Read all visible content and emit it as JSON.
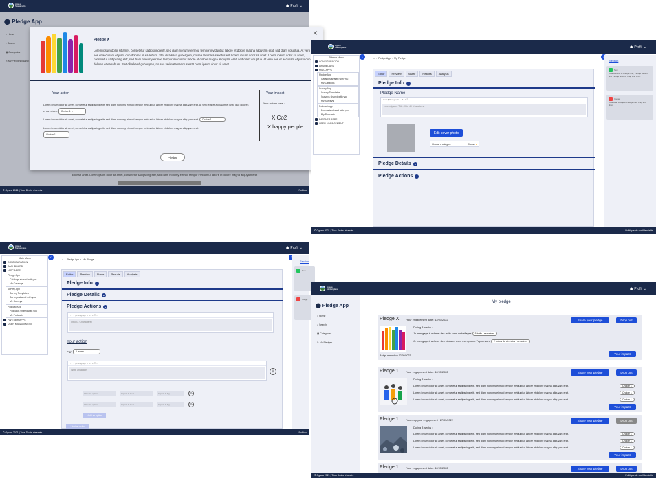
{
  "brand": {
    "logo_line1": "Agsea",
    "logo_line2": "Sustainable",
    "logo_line3": "Marketplace",
    "profile": "Profil"
  },
  "footer": {
    "copyright": "© Ogsea 2021 | Tous Droits réservés",
    "privacy": "Politique de confidentialité",
    "privacy_short": "Politiqu"
  },
  "p1": {
    "app_title": "Pledge App",
    "nav": [
      "Home",
      "Search",
      "Categories",
      "My Pledges (Blank)"
    ],
    "modal": {
      "title": "Pledge X",
      "desc": "Lorem ipsum dolor sit amet, consetetur sadipscing elitr, sed diam nonumy eirmod tempor invidunt ut labore et dolore magna aliquyam erat, sed diam voluptua. At vero eos et accusam et justo duo dolores et ea rebum. Stet clita kasd gubergren, no sea takimata sanctus est Lorem ipsum dolor sit amet. Lorem ipsum dolor sit amet, consetetur sadipscing elitr, sed diam nonumy eirmod tempor invidunt ut labore et dolore magna aliquyam erat, sed diam voluptua. At vero eos et accusam et justo duo dolores et ea rebum. Stet clita kasd gubergren, no sea takimata sanctus est Lorem ipsum dolor sit amet.",
      "your_action": "Your action",
      "line1": "Lorem ipsum dolor sit amet, consetetur sadipscing elitr, sed diam nonumy eirmod tempor invidunt ut labore et dolore magna aliquyam erat. At vero eos et accusam et justo duo dolores et ea rebum.",
      "line2": "Lorem ipsum dolor sit amet, consetetur sadipscing elitr, sed diam nonumy eirmod tempor invidunt ut labore et dolore magna aliquyam erat.",
      "line3": "Lorem ipsum dolor sit amet, consetetur sadipscing elitr, sed diam nonumy eirmod tempor invidunt ut labore et dolore magna aliquyam erat.",
      "choice": "Choice 1",
      "your_impact": "Your impact",
      "actions_save": "Your actions save :",
      "impact1": "X Co2",
      "impact2": "X happy people",
      "pledge_btn": "Pledge",
      "close": "×"
    },
    "bg_text": "dolor sit amet. Lorem ipsum dolor sit amet, consetetur sadipscing elitr, sed diam nonumy eirmod tempor invidunt ut labore et dolore magna aliquyam erat"
  },
  "p2": {
    "menu_title": "Sidebar Menu",
    "menu": [
      "CONFIGURATION",
      "DASHBOARD",
      "MISC APPS",
      "Pledge App",
      "Catalogs shared with you",
      "My Catalogs",
      "Survey App",
      "Survey Templates",
      "Surveys shared with you",
      "My Surveys",
      "Podcast App",
      "Podcasts shared with you",
      "My Podcasts",
      "PARTNER APPS",
      "USER MANAGEMENT"
    ],
    "breadcrumb": [
      "Pledge App",
      "My Pledge"
    ],
    "tabs": [
      "Editor",
      "Preview",
      "Share",
      "Results",
      "Analysis"
    ],
    "pledge_info": "Pledge Info",
    "pledge_name": "Pledge Name",
    "editor_placeholder": "Lorem ipsum Title (X to 40 characters)",
    "edit_cover": "Edit cover photo",
    "choose_cat": "Choose a category",
    "cat_val": "Choose",
    "pledge_details": "Pledge Details",
    "pledge_actions": "Pledge Actions",
    "section": "Section",
    "card1_title": "Text",
    "card1_text": "To add a text in Pledge info, Pledge details and Pledge actions, drag and drop.",
    "card2_title": "Image",
    "card2_text": "To add an image in Pledge info, drag and drop."
  },
  "p3": {
    "menu_title": "Main Menu",
    "menu": [
      "CONFIGURATION",
      "DASHBOARD",
      "MISC APPS",
      "Pledge App",
      "Catalogs shared with you",
      "My Catalogs",
      "Survey App",
      "Survey Templates",
      "Surveys shared with you",
      "My Surveys",
      "Podcast App",
      "Podcasts shared with you",
      "My Podcasts",
      "PARTNER APPS",
      "USER MANAGEMENT"
    ],
    "breadcrumb": [
      "Pledge App",
      "My Pledge"
    ],
    "tabs": [
      "Editor",
      "Preview",
      "Share",
      "Results",
      "Analysis"
    ],
    "pledge_info": "Pledge Info",
    "pledge_details": "Pledge Details",
    "pledge_actions": "Pledge Actions",
    "editor_placeholder": "Intro (X Characters)",
    "your_action": "Your action",
    "for_label": "For",
    "for_val": "1 week",
    "action_placeholder": "Write an action",
    "opt1": "Write an option",
    "opt2": "Impact in Co2",
    "opt3": "Impact in Kg",
    "add_option": "Add an option",
    "add_action": "Add an action",
    "section": "Section",
    "card1_title": "Text",
    "card2_title": "Image"
  },
  "p4": {
    "app_title": "Pledge App",
    "nav": [
      "Home",
      "Search",
      "Categories",
      "My Pledges"
    ],
    "page_title": "My pledge",
    "cards": [
      {
        "title": "Pledge X",
        "date": "Your engagement date : 12/01/2022",
        "during": "During 3 weeks :",
        "l1": "Je m'engage à acheter des fruits sans emballages",
        "p1": "5 fruits / semaines",
        "l2": "Je m'engage à acheter des céréales avec mon propre Tupperware",
        "p2": "2 boites de céréales / semaines",
        "badge": "Badge earned on 12/09/2022"
      },
      {
        "title": "Pledge 1",
        "date": "Your engagement date : 12/05/2022",
        "during": "During 3 weeks :",
        "line": "Lorem ipsum dolor sit amet, consetetur sadipscing elitr, sed diam nonumy eirmod tempor invidunt ut labore et dolore magna aliquyam erat.",
        "choice": "Choice 1"
      },
      {
        "title": "Pledge 1",
        "date": "You drop your engagement : 27/05/2022",
        "during": "During 3 weeks :",
        "line": "Lorem ipsum dolor sit amet, consetetur sadipscing elitr, sed diam nonumy eirmod tempor invidunt ut labore et dolore magna aliquyam erat.",
        "choice": "Choice 1"
      },
      {
        "title": "Pledge 1",
        "date": "Your engagement date : 12/05/2022"
      }
    ],
    "share": "Share your pledge",
    "drop": "Drop out",
    "impact": "Your impact"
  }
}
